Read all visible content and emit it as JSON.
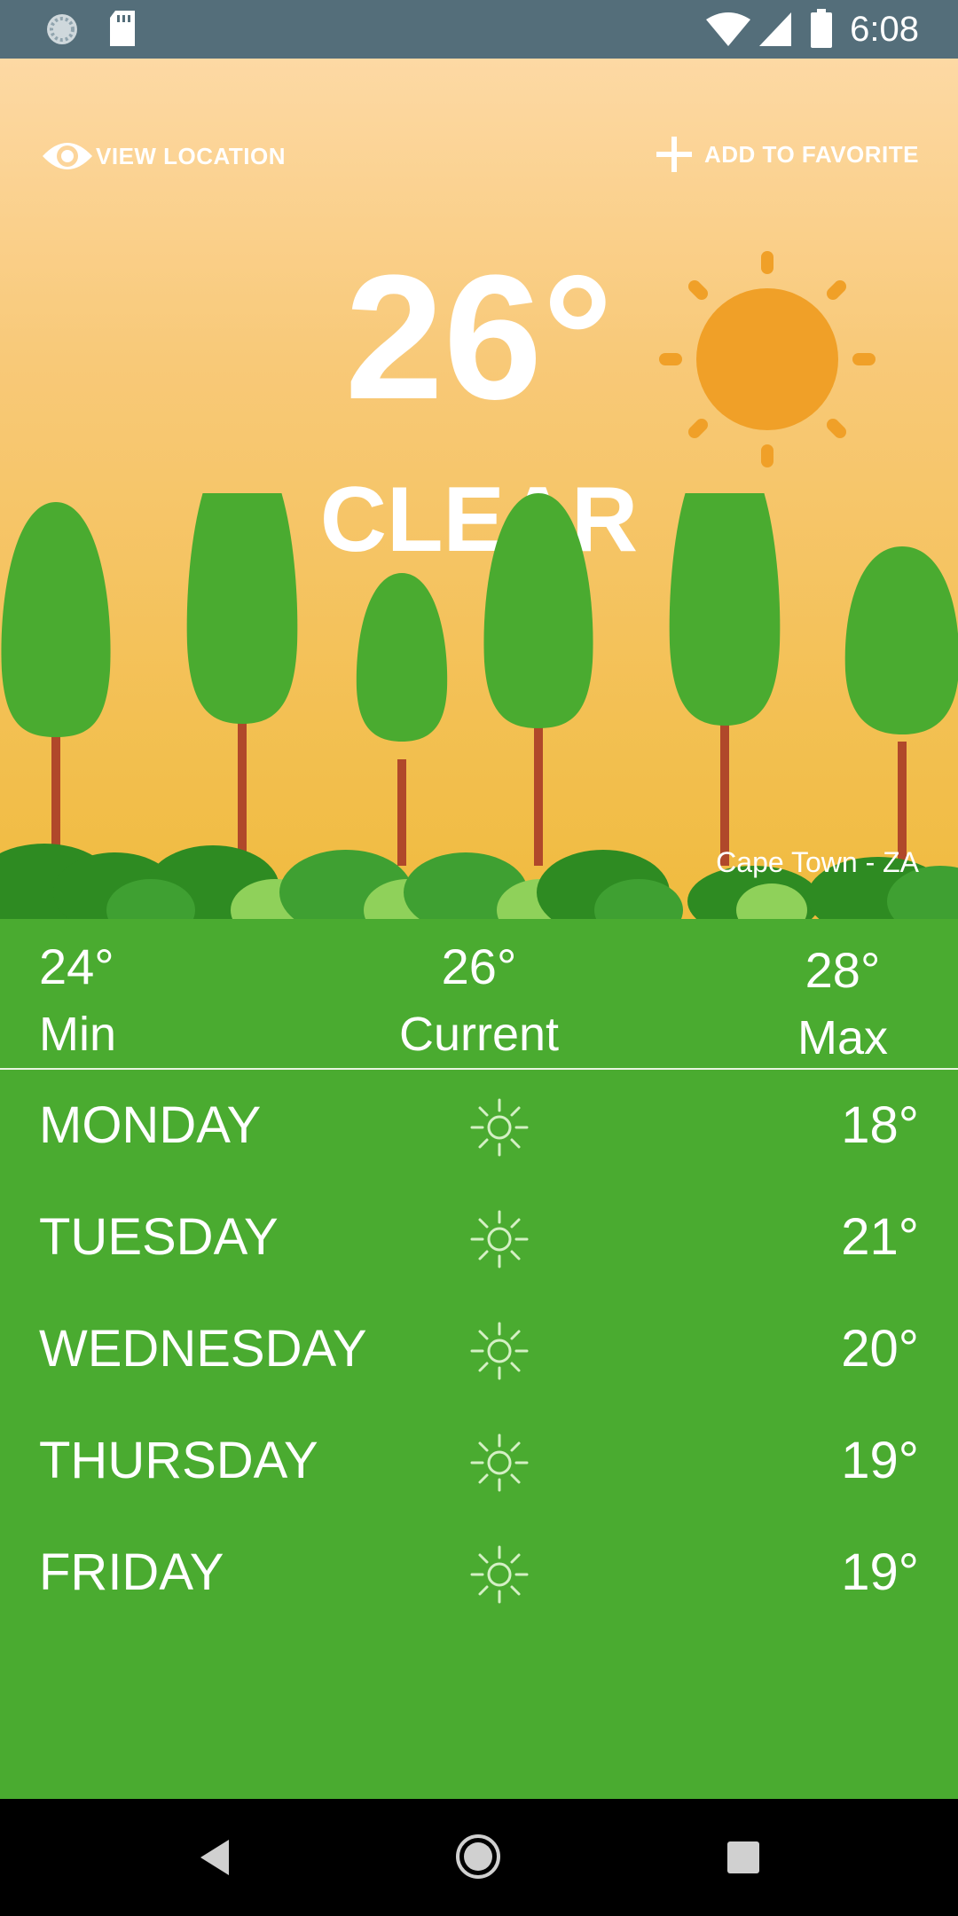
{
  "status_bar": {
    "time": "6:08"
  },
  "actions": {
    "view_location_label": "VIEW LOCATION",
    "add_favorite_label": "ADD TO FAVORITE"
  },
  "current": {
    "temperature": "26°",
    "condition": "CLEAR",
    "location": "Cape Town - ZA"
  },
  "summary": {
    "min": {
      "value": "24°",
      "label": "Min"
    },
    "current": {
      "value": "26°",
      "label": "Current"
    },
    "max": {
      "value": "28°",
      "label": "Max"
    }
  },
  "forecast": [
    {
      "day": "MONDAY",
      "icon": "sun-icon",
      "temp": "18°"
    },
    {
      "day": "TUESDAY",
      "icon": "sun-icon",
      "temp": "21°"
    },
    {
      "day": "WEDNESDAY",
      "icon": "sun-icon",
      "temp": "20°"
    },
    {
      "day": "THURSDAY",
      "icon": "sun-icon",
      "temp": "19°"
    },
    {
      "day": "FRIDAY",
      "icon": "sun-icon",
      "temp": "19°"
    }
  ],
  "colors": {
    "status_bar": "#546e7a",
    "sky_top": "#fdd9a4",
    "sky_bottom": "#f0bb3e",
    "sun": "#f0a028",
    "tree": "#4aab30",
    "panel": "#4aab30"
  }
}
